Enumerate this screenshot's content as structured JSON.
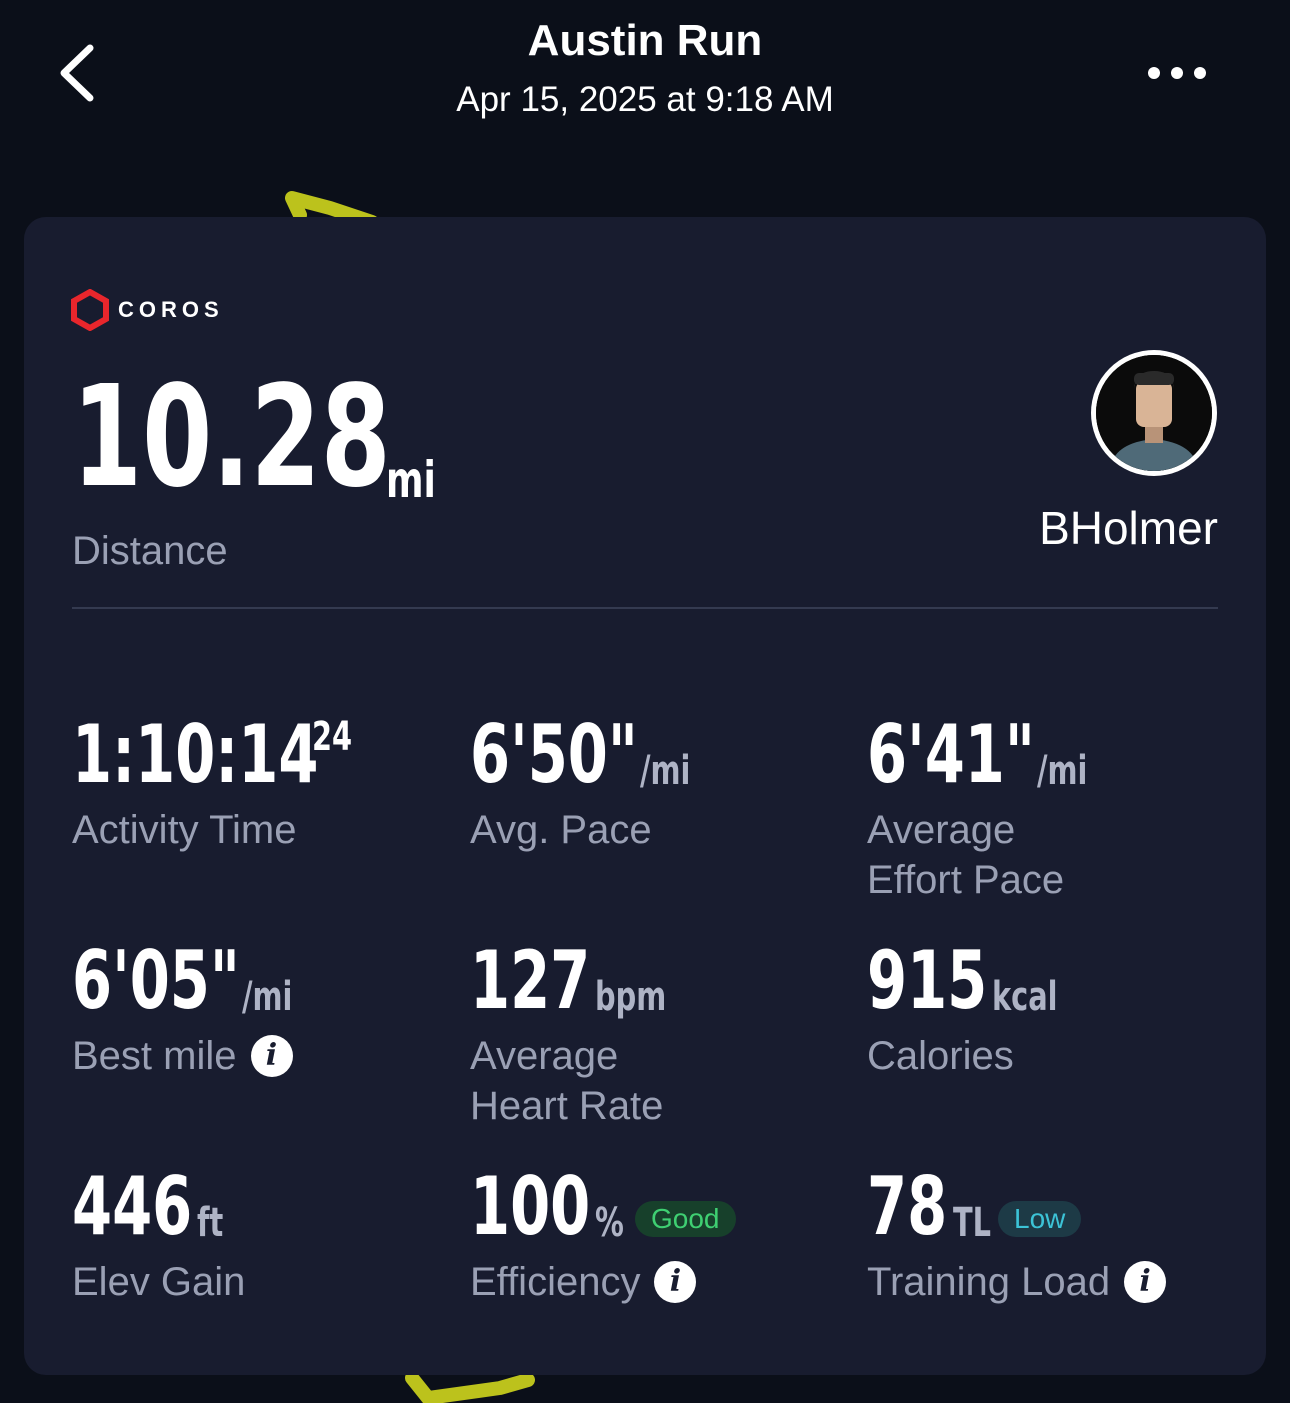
{
  "header": {
    "title": "Austin Run",
    "subtitle": "Apr 15, 2025 at 9:18 AM"
  },
  "brand": {
    "name": "COROS",
    "accent": "#e8262c"
  },
  "distance": {
    "value": "10.28",
    "unit": "mi",
    "label": "Distance"
  },
  "user": {
    "name": "BHolmer"
  },
  "stats": {
    "activity_time": {
      "value": "1:10:14",
      "sup": "24",
      "label": "Activity Time"
    },
    "avg_pace": {
      "value": "6'50\"",
      "unit": "/mi",
      "label": "Avg. Pace"
    },
    "avg_effort_pace": {
      "value": "6'41\"",
      "unit": "/mi",
      "label_line1": "Average",
      "label_line2": "Effort Pace"
    },
    "best_mile": {
      "value": "6'05\"",
      "unit": "/mi",
      "label": "Best mile"
    },
    "avg_heart_rate": {
      "value": "127",
      "unit": "bpm",
      "label_line1": "Average",
      "label_line2": "Heart Rate"
    },
    "calories": {
      "value": "915",
      "unit": "kcal",
      "label": "Calories"
    },
    "elev_gain": {
      "value": "446",
      "unit": "ft",
      "label": "Elev Gain"
    },
    "efficiency": {
      "value": "100",
      "unit": "%",
      "badge": "Good",
      "label": "Efficiency"
    },
    "training_load": {
      "value": "78",
      "unit": "TL",
      "badge": "Low",
      "label": "Training Load"
    }
  },
  "colors": {
    "background": "#0b0f19",
    "card": "#181c2f",
    "route": "#c8cc1a",
    "good": "#3fcf72",
    "low": "#3cc3d6"
  },
  "icons": [
    "back-chevron-icon",
    "more-dots-icon",
    "coros-logo-icon",
    "info-icon"
  ]
}
